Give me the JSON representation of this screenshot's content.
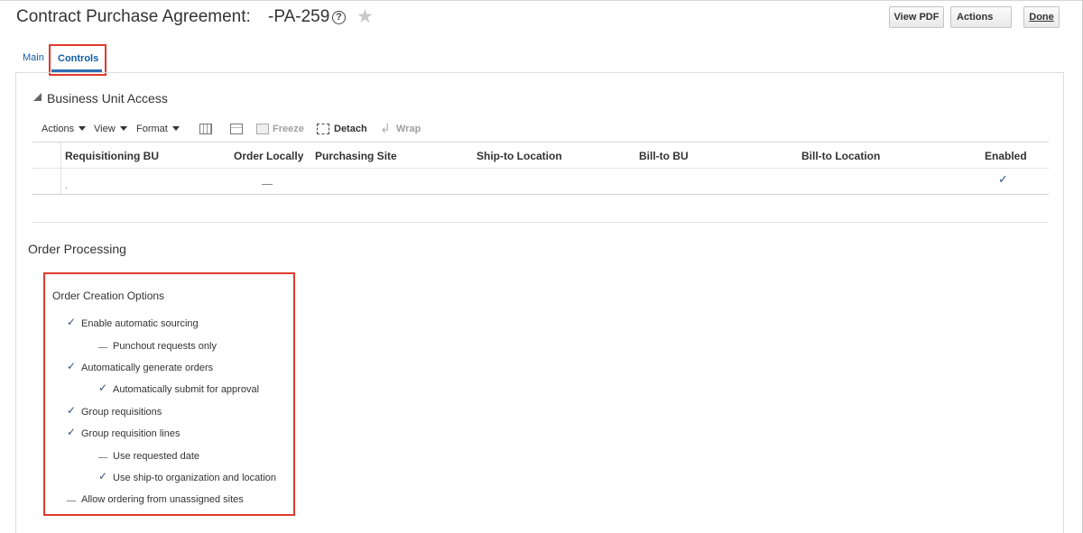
{
  "header": {
    "title": "Contract Purchase Agreement:",
    "number": "-PA-259",
    "help_icon": "?",
    "favorite_icon": "★",
    "buttons": {
      "view_pdf": "View PDF",
      "actions": "Actions",
      "done": "Done"
    }
  },
  "tabs": [
    {
      "label": "Main",
      "selected": false
    },
    {
      "label": "Controls",
      "selected": true
    }
  ],
  "business_unit_access": {
    "title": "Business Unit Access",
    "toolbar": {
      "actions": "Actions",
      "view": "View",
      "format": "Format",
      "freeze": "Freeze",
      "detach": "Detach",
      "wrap": "Wrap"
    },
    "columns": [
      "Requisitioning BU",
      "Order Locally",
      "Purchasing Site",
      "Ship-to Location",
      "Bill-to BU",
      "Bill-to Location",
      "Enabled"
    ],
    "rows": [
      {
        "requisitioning_bu": ".",
        "order_locally": false,
        "purchasing_site": "",
        "ship_to_location": "",
        "bill_to_bu": "",
        "bill_to_location": "",
        "enabled": true
      }
    ]
  },
  "order_processing": {
    "title": "Order Processing",
    "group_title": "Order Creation Options",
    "options": [
      {
        "label": "Enable automatic sourcing",
        "checked": true,
        "level": 0
      },
      {
        "label": "Punchout requests only",
        "checked": false,
        "level": 1
      },
      {
        "label": "Automatically generate orders",
        "checked": true,
        "level": 0
      },
      {
        "label": "Automatically submit for approval",
        "checked": true,
        "level": 1
      },
      {
        "label": "Group requisitions",
        "checked": true,
        "level": 0
      },
      {
        "label": "Group requisition lines",
        "checked": true,
        "level": 0
      },
      {
        "label": "Use requested date",
        "checked": false,
        "level": 1
      },
      {
        "label": "Use ship-to organization and location",
        "checked": true,
        "level": 1
      },
      {
        "label": "Allow ordering from unassigned sites",
        "checked": false,
        "level": 0
      }
    ]
  },
  "colors": {
    "link": "#0e5fa8",
    "check": "#31537f",
    "highlight_box": "#e03a2c"
  }
}
